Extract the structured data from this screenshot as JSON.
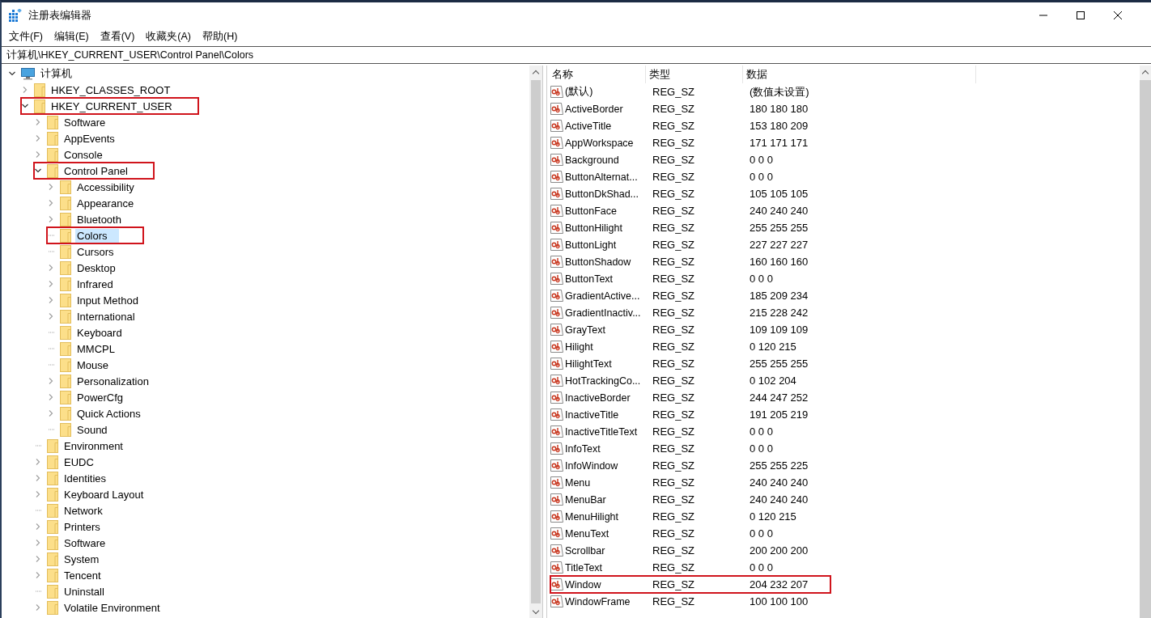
{
  "window": {
    "title": "注册表编辑器"
  },
  "menu": [
    "文件(F)",
    "编辑(E)",
    "查看(V)",
    "收藏夹(A)",
    "帮助(H)"
  ],
  "address": {
    "value": "计算机\\HKEY_CURRENT_USER\\Control Panel\\Colors"
  },
  "tree": {
    "label": "计算机",
    "kind": "computer",
    "has_children": true,
    "expanded": true,
    "selected": false,
    "highlighted": false,
    "children": [
      {
        "label": "HKEY_CLASSES_ROOT",
        "has_children": true,
        "expanded": false,
        "selected": false,
        "highlighted": false
      },
      {
        "label": "HKEY_CURRENT_USER",
        "has_children": true,
        "expanded": true,
        "selected": false,
        "highlighted": true,
        "children": [
          {
            "label": "Software",
            "has_children": true,
            "expanded": false,
            "selected": false,
            "highlighted": false
          },
          {
            "label": "AppEvents",
            "has_children": true,
            "expanded": false,
            "selected": false,
            "highlighted": false
          },
          {
            "label": "Console",
            "has_children": true,
            "expanded": false,
            "selected": false,
            "highlighted": false
          },
          {
            "label": "Control Panel",
            "has_children": true,
            "expanded": true,
            "selected": false,
            "highlighted": true,
            "children": [
              {
                "label": "Accessibility",
                "has_children": true,
                "expanded": false,
                "selected": false,
                "highlighted": false
              },
              {
                "label": "Appearance",
                "has_children": true,
                "expanded": false,
                "selected": false,
                "highlighted": false
              },
              {
                "label": "Bluetooth",
                "has_children": true,
                "expanded": false,
                "selected": false,
                "highlighted": false
              },
              {
                "label": "Colors",
                "has_children": false,
                "expanded": false,
                "selected": true,
                "highlighted": true
              },
              {
                "label": "Cursors",
                "has_children": false,
                "expanded": false,
                "selected": false,
                "highlighted": false
              },
              {
                "label": "Desktop",
                "has_children": true,
                "expanded": false,
                "selected": false,
                "highlighted": false
              },
              {
                "label": "Infrared",
                "has_children": true,
                "expanded": false,
                "selected": false,
                "highlighted": false
              },
              {
                "label": "Input Method",
                "has_children": true,
                "expanded": false,
                "selected": false,
                "highlighted": false
              },
              {
                "label": "International",
                "has_children": true,
                "expanded": false,
                "selected": false,
                "highlighted": false
              },
              {
                "label": "Keyboard",
                "has_children": false,
                "expanded": false,
                "selected": false,
                "highlighted": false
              },
              {
                "label": "MMCPL",
                "has_children": false,
                "expanded": false,
                "selected": false,
                "highlighted": false
              },
              {
                "label": "Mouse",
                "has_children": false,
                "expanded": false,
                "selected": false,
                "highlighted": false
              },
              {
                "label": "Personalization",
                "has_children": true,
                "expanded": false,
                "selected": false,
                "highlighted": false
              },
              {
                "label": "PowerCfg",
                "has_children": true,
                "expanded": false,
                "selected": false,
                "highlighted": false
              },
              {
                "label": "Quick Actions",
                "has_children": true,
                "expanded": false,
                "selected": false,
                "highlighted": false
              },
              {
                "label": "Sound",
                "has_children": false,
                "expanded": false,
                "selected": false,
                "highlighted": false
              }
            ]
          },
          {
            "label": "Environment",
            "has_children": false,
            "expanded": false,
            "selected": false,
            "highlighted": false
          },
          {
            "label": "EUDC",
            "has_children": true,
            "expanded": false,
            "selected": false,
            "highlighted": false
          },
          {
            "label": "Identities",
            "has_children": true,
            "expanded": false,
            "selected": false,
            "highlighted": false
          },
          {
            "label": "Keyboard Layout",
            "has_children": true,
            "expanded": false,
            "selected": false,
            "highlighted": false
          },
          {
            "label": "Network",
            "has_children": false,
            "expanded": false,
            "selected": false,
            "highlighted": false
          },
          {
            "label": "Printers",
            "has_children": true,
            "expanded": false,
            "selected": false,
            "highlighted": false
          },
          {
            "label": "Software",
            "has_children": true,
            "expanded": false,
            "selected": false,
            "highlighted": false
          },
          {
            "label": "System",
            "has_children": true,
            "expanded": false,
            "selected": false,
            "highlighted": false
          },
          {
            "label": "Tencent",
            "has_children": true,
            "expanded": false,
            "selected": false,
            "highlighted": false
          },
          {
            "label": "Uninstall",
            "has_children": false,
            "expanded": false,
            "selected": false,
            "highlighted": false
          },
          {
            "label": "Volatile Environment",
            "has_children": true,
            "expanded": false,
            "selected": false,
            "highlighted": false
          }
        ]
      }
    ]
  },
  "values": {
    "columns": [
      "名称",
      "类型",
      "数据"
    ],
    "rows": [
      {
        "name": "(默认)",
        "type": "REG_SZ",
        "data": "(数值未设置)",
        "selected": false,
        "highlighted": false
      },
      {
        "name": "ActiveBorder",
        "type": "REG_SZ",
        "data": "180 180 180",
        "selected": false,
        "highlighted": false
      },
      {
        "name": "ActiveTitle",
        "type": "REG_SZ",
        "data": "153 180 209",
        "selected": false,
        "highlighted": false
      },
      {
        "name": "AppWorkspace",
        "type": "REG_SZ",
        "data": "171 171 171",
        "selected": false,
        "highlighted": false
      },
      {
        "name": "Background",
        "type": "REG_SZ",
        "data": "0 0 0",
        "selected": false,
        "highlighted": false
      },
      {
        "name": "ButtonAlternat...",
        "type": "REG_SZ",
        "data": "0 0 0",
        "selected": false,
        "highlighted": false
      },
      {
        "name": "ButtonDkShad...",
        "type": "REG_SZ",
        "data": "105 105 105",
        "selected": false,
        "highlighted": false
      },
      {
        "name": "ButtonFace",
        "type": "REG_SZ",
        "data": "240 240 240",
        "selected": false,
        "highlighted": false
      },
      {
        "name": "ButtonHilight",
        "type": "REG_SZ",
        "data": "255 255 255",
        "selected": false,
        "highlighted": false
      },
      {
        "name": "ButtonLight",
        "type": "REG_SZ",
        "data": "227 227 227",
        "selected": false,
        "highlighted": false
      },
      {
        "name": "ButtonShadow",
        "type": "REG_SZ",
        "data": "160 160 160",
        "selected": false,
        "highlighted": false
      },
      {
        "name": "ButtonText",
        "type": "REG_SZ",
        "data": "0 0 0",
        "selected": false,
        "highlighted": false
      },
      {
        "name": "GradientActive...",
        "type": "REG_SZ",
        "data": "185 209 234",
        "selected": false,
        "highlighted": false
      },
      {
        "name": "GradientInactiv...",
        "type": "REG_SZ",
        "data": "215 228 242",
        "selected": false,
        "highlighted": false
      },
      {
        "name": "GrayText",
        "type": "REG_SZ",
        "data": "109 109 109",
        "selected": false,
        "highlighted": false
      },
      {
        "name": "Hilight",
        "type": "REG_SZ",
        "data": "0 120 215",
        "selected": false,
        "highlighted": false
      },
      {
        "name": "HilightText",
        "type": "REG_SZ",
        "data": "255 255 255",
        "selected": false,
        "highlighted": false
      },
      {
        "name": "HotTrackingCo...",
        "type": "REG_SZ",
        "data": "0 102 204",
        "selected": false,
        "highlighted": false
      },
      {
        "name": "InactiveBorder",
        "type": "REG_SZ",
        "data": "244 247 252",
        "selected": false,
        "highlighted": false
      },
      {
        "name": "InactiveTitle",
        "type": "REG_SZ",
        "data": "191 205 219",
        "selected": false,
        "highlighted": false
      },
      {
        "name": "InactiveTitleText",
        "type": "REG_SZ",
        "data": "0 0 0",
        "selected": false,
        "highlighted": false
      },
      {
        "name": "InfoText",
        "type": "REG_SZ",
        "data": "0 0 0",
        "selected": false,
        "highlighted": false
      },
      {
        "name": "InfoWindow",
        "type": "REG_SZ",
        "data": "255 255 225",
        "selected": false,
        "highlighted": false
      },
      {
        "name": "Menu",
        "type": "REG_SZ",
        "data": "240 240 240",
        "selected": false,
        "highlighted": false
      },
      {
        "name": "MenuBar",
        "type": "REG_SZ",
        "data": "240 240 240",
        "selected": false,
        "highlighted": false
      },
      {
        "name": "MenuHilight",
        "type": "REG_SZ",
        "data": "0 120 215",
        "selected": false,
        "highlighted": false
      },
      {
        "name": "MenuText",
        "type": "REG_SZ",
        "data": "0 0 0",
        "selected": false,
        "highlighted": false
      },
      {
        "name": "Scrollbar",
        "type": "REG_SZ",
        "data": "200 200 200",
        "selected": false,
        "highlighted": false
      },
      {
        "name": "TitleText",
        "type": "REG_SZ",
        "data": "0 0 0",
        "selected": false,
        "highlighted": false
      },
      {
        "name": "Window",
        "type": "REG_SZ",
        "data": "204 232 207",
        "selected": false,
        "highlighted": true
      },
      {
        "name": "WindowFrame",
        "type": "REG_SZ",
        "data": "100 100 100",
        "selected": false,
        "highlighted": false
      }
    ]
  }
}
